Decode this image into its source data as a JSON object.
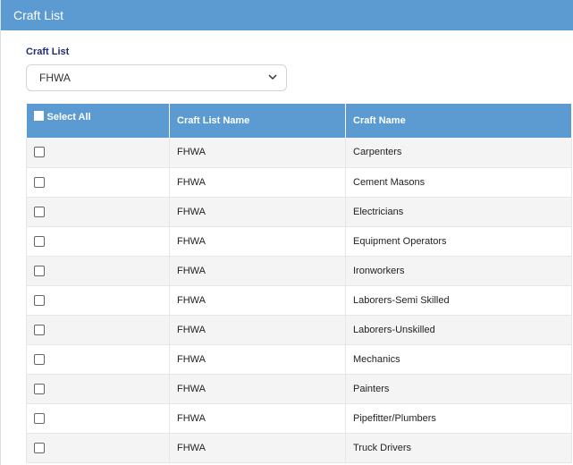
{
  "header": {
    "title": "Craft List"
  },
  "filter": {
    "label": "Craft List",
    "selected": "FHWA"
  },
  "table": {
    "columns": {
      "select_all": "Select All",
      "list_name": "Craft List Name",
      "craft_name": "Craft Name"
    },
    "rows": [
      {
        "list_name": "FHWA",
        "craft_name": "Carpenters"
      },
      {
        "list_name": "FHWA",
        "craft_name": "Cement Masons"
      },
      {
        "list_name": "FHWA",
        "craft_name": "Electricians"
      },
      {
        "list_name": "FHWA",
        "craft_name": "Equipment Operators"
      },
      {
        "list_name": "FHWA",
        "craft_name": "Ironworkers"
      },
      {
        "list_name": "FHWA",
        "craft_name": "Laborers-Semi Skilled"
      },
      {
        "list_name": "FHWA",
        "craft_name": "Laborers-Unskilled"
      },
      {
        "list_name": "FHWA",
        "craft_name": "Mechanics"
      },
      {
        "list_name": "FHWA",
        "craft_name": "Painters"
      },
      {
        "list_name": "FHWA",
        "craft_name": "Pipefitter/Plumbers"
      },
      {
        "list_name": "FHWA",
        "craft_name": "Truck Drivers"
      }
    ]
  },
  "icons": {
    "dropdown": "chevron-down-icon",
    "checkbox": "checkbox-icon"
  },
  "colors": {
    "header": "#5b9bd1",
    "label": "#1f2f6b"
  }
}
